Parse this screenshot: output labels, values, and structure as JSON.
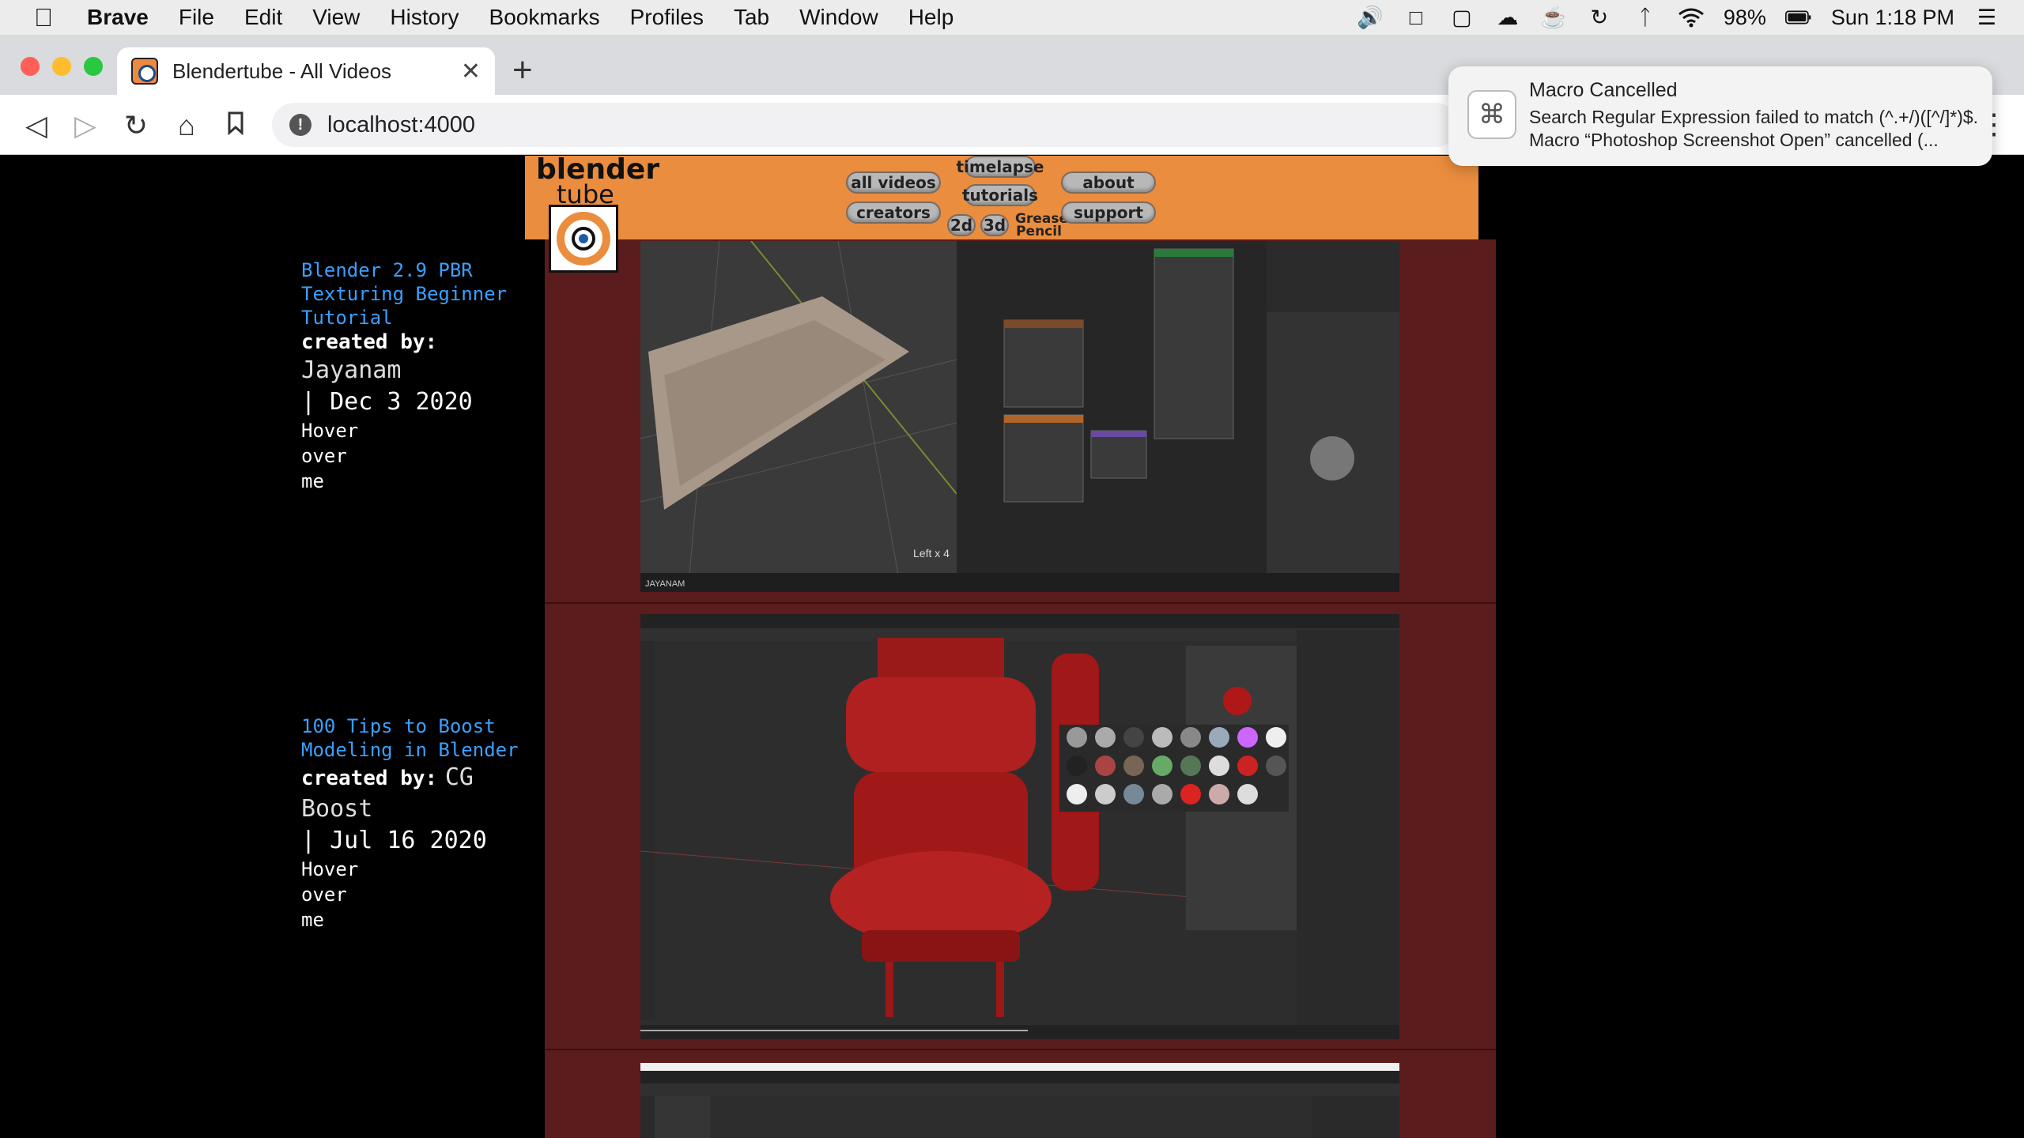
{
  "menubar": {
    "app": "Brave",
    "items": [
      "File",
      "Edit",
      "View",
      "History",
      "Bookmarks",
      "Profiles",
      "Tab",
      "Window",
      "Help"
    ],
    "battery": "98%",
    "clock": "Sun 1:18 PM"
  },
  "browser": {
    "tab_title": "Blendertube - All Videos",
    "url": "localhost:4000"
  },
  "notification": {
    "title": "Macro Cancelled",
    "body": "Search Regular Expression failed to match (^.+/)([^/]*)$. Macro “Photoshop Screenshot Open” cancelled (..."
  },
  "site": {
    "logo_top": "blender",
    "logo_bottom": "tube",
    "nav": {
      "all_videos": "all videos",
      "creators": "creators",
      "timelapse": "timelapse",
      "tutorials": "tutorials",
      "about": "about",
      "support": "support",
      "two_d": "2d",
      "three_d": "3d",
      "grease_pencil": "Grease Pencil"
    }
  },
  "videos": [
    {
      "title": "Blender 2.9 PBR Texturing Beginner Tutorial",
      "created_by_label": "created by:",
      "author": "Jayanam",
      "date": "| Dec 3 2020",
      "hover": "Hover over me",
      "overlay_text": "Left x 4",
      "channel": "JAYANAM"
    },
    {
      "title": "100 Tips to Boost Modeling in Blender",
      "created_by_label": "created by:",
      "author": "CG Boost",
      "date": "| Jul 16 2020",
      "hover": "Hover over me"
    }
  ],
  "colors": {
    "header_orange": "#ea8d3f",
    "content_maroon": "#5a1c1c",
    "link_blue": "#3aa0ff"
  }
}
